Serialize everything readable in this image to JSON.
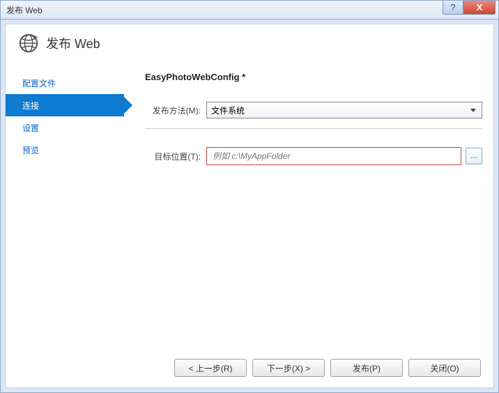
{
  "window": {
    "title": "发布 Web"
  },
  "header": {
    "title": "发布 Web"
  },
  "sidebar": {
    "items": [
      {
        "label": "配置文件"
      },
      {
        "label": "连接"
      },
      {
        "label": "设置"
      },
      {
        "label": "预览"
      }
    ]
  },
  "main": {
    "profile_name": "EasyPhotoWebConfig *",
    "publish_method_label": "发布方法(M):",
    "publish_method_value": "文件系统",
    "target_location_label": "目标位置(T):",
    "target_location_placeholder": "例如 c:\\MyAppFolder",
    "browse_label": "..."
  },
  "footer": {
    "prev": "< 上一步(R)",
    "next": "下一步(X) >",
    "publish": "发布(P)",
    "close": "关闭(O)"
  },
  "titlebar_controls": {
    "help": "?",
    "close": "X"
  }
}
